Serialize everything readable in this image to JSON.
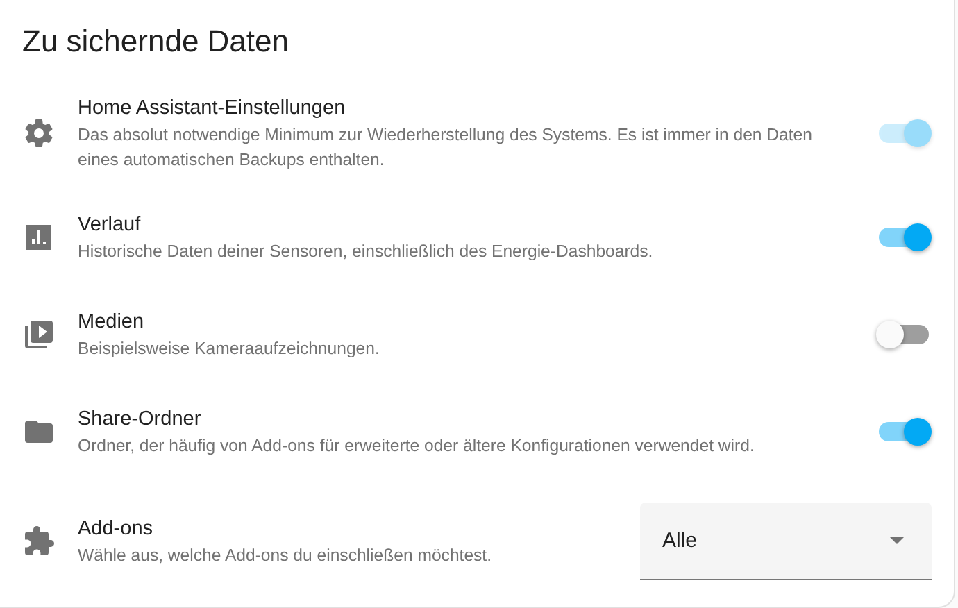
{
  "title": "Zu sichernde Daten",
  "items": [
    {
      "kind": "toggle",
      "label": "Home Assistant-Einstellungen",
      "description": "Das absolut notwendige Minimum zur Wiederherstellung des Systems. Es ist immer in den Daten eines automatischen Backups enthalten.",
      "on": true,
      "disabled": true
    },
    {
      "kind": "toggle",
      "label": "Verlauf",
      "description": "Historische Daten deiner Sensoren, einschließlich des Energie-Dashboards.",
      "on": true,
      "disabled": false
    },
    {
      "kind": "toggle",
      "label": "Medien",
      "description": "Beispielsweise Kameraaufzeichnungen.",
      "on": false,
      "disabled": false
    },
    {
      "kind": "toggle",
      "label": "Share-Ordner",
      "description": "Ordner, der häufig von Add-ons für erweiterte oder ältere Konfigurationen verwendet wird.",
      "on": true,
      "disabled": false
    },
    {
      "kind": "select",
      "label": "Add-ons",
      "description": "Wähle aus, welche Add-ons du einschließen möchtest.",
      "value": "Alle"
    }
  ]
}
